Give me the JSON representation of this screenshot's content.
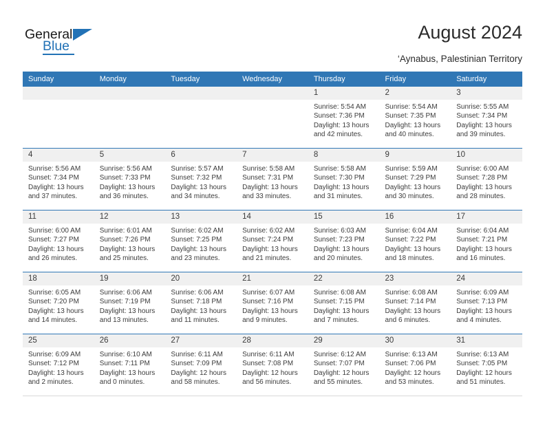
{
  "brand": {
    "name_top": "General",
    "name_bottom": "Blue",
    "accent_color": "#2272b6"
  },
  "header": {
    "title": "August 2024",
    "subtitle": "‘Aynabus, Palestinian Territory"
  },
  "theme": {
    "header_blue": "#3077b5",
    "daynum_band": "#f0f0f0",
    "text": "#3b3b3b"
  },
  "weekdays": [
    "Sunday",
    "Monday",
    "Tuesday",
    "Wednesday",
    "Thursday",
    "Friday",
    "Saturday"
  ],
  "labels": {
    "sunrise_prefix": "Sunrise:",
    "sunset_prefix": "Sunset:",
    "daylight_prefix": "Daylight:"
  },
  "weeks": [
    [
      {
        "day": "",
        "lines": []
      },
      {
        "day": "",
        "lines": []
      },
      {
        "day": "",
        "lines": []
      },
      {
        "day": "",
        "lines": []
      },
      {
        "day": "1",
        "lines": [
          "Sunrise: 5:54 AM",
          "Sunset: 7:36 PM",
          "Daylight: 13 hours",
          "and 42 minutes."
        ]
      },
      {
        "day": "2",
        "lines": [
          "Sunrise: 5:54 AM",
          "Sunset: 7:35 PM",
          "Daylight: 13 hours",
          "and 40 minutes."
        ]
      },
      {
        "day": "3",
        "lines": [
          "Sunrise: 5:55 AM",
          "Sunset: 7:34 PM",
          "Daylight: 13 hours",
          "and 39 minutes."
        ]
      }
    ],
    [
      {
        "day": "4",
        "lines": [
          "Sunrise: 5:56 AM",
          "Sunset: 7:34 PM",
          "Daylight: 13 hours",
          "and 37 minutes."
        ]
      },
      {
        "day": "5",
        "lines": [
          "Sunrise: 5:56 AM",
          "Sunset: 7:33 PM",
          "Daylight: 13 hours",
          "and 36 minutes."
        ]
      },
      {
        "day": "6",
        "lines": [
          "Sunrise: 5:57 AM",
          "Sunset: 7:32 PM",
          "Daylight: 13 hours",
          "and 34 minutes."
        ]
      },
      {
        "day": "7",
        "lines": [
          "Sunrise: 5:58 AM",
          "Sunset: 7:31 PM",
          "Daylight: 13 hours",
          "and 33 minutes."
        ]
      },
      {
        "day": "8",
        "lines": [
          "Sunrise: 5:58 AM",
          "Sunset: 7:30 PM",
          "Daylight: 13 hours",
          "and 31 minutes."
        ]
      },
      {
        "day": "9",
        "lines": [
          "Sunrise: 5:59 AM",
          "Sunset: 7:29 PM",
          "Daylight: 13 hours",
          "and 30 minutes."
        ]
      },
      {
        "day": "10",
        "lines": [
          "Sunrise: 6:00 AM",
          "Sunset: 7:28 PM",
          "Daylight: 13 hours",
          "and 28 minutes."
        ]
      }
    ],
    [
      {
        "day": "11",
        "lines": [
          "Sunrise: 6:00 AM",
          "Sunset: 7:27 PM",
          "Daylight: 13 hours",
          "and 26 minutes."
        ]
      },
      {
        "day": "12",
        "lines": [
          "Sunrise: 6:01 AM",
          "Sunset: 7:26 PM",
          "Daylight: 13 hours",
          "and 25 minutes."
        ]
      },
      {
        "day": "13",
        "lines": [
          "Sunrise: 6:02 AM",
          "Sunset: 7:25 PM",
          "Daylight: 13 hours",
          "and 23 minutes."
        ]
      },
      {
        "day": "14",
        "lines": [
          "Sunrise: 6:02 AM",
          "Sunset: 7:24 PM",
          "Daylight: 13 hours",
          "and 21 minutes."
        ]
      },
      {
        "day": "15",
        "lines": [
          "Sunrise: 6:03 AM",
          "Sunset: 7:23 PM",
          "Daylight: 13 hours",
          "and 20 minutes."
        ]
      },
      {
        "day": "16",
        "lines": [
          "Sunrise: 6:04 AM",
          "Sunset: 7:22 PM",
          "Daylight: 13 hours",
          "and 18 minutes."
        ]
      },
      {
        "day": "17",
        "lines": [
          "Sunrise: 6:04 AM",
          "Sunset: 7:21 PM",
          "Daylight: 13 hours",
          "and 16 minutes."
        ]
      }
    ],
    [
      {
        "day": "18",
        "lines": [
          "Sunrise: 6:05 AM",
          "Sunset: 7:20 PM",
          "Daylight: 13 hours",
          "and 14 minutes."
        ]
      },
      {
        "day": "19",
        "lines": [
          "Sunrise: 6:06 AM",
          "Sunset: 7:19 PM",
          "Daylight: 13 hours",
          "and 13 minutes."
        ]
      },
      {
        "day": "20",
        "lines": [
          "Sunrise: 6:06 AM",
          "Sunset: 7:18 PM",
          "Daylight: 13 hours",
          "and 11 minutes."
        ]
      },
      {
        "day": "21",
        "lines": [
          "Sunrise: 6:07 AM",
          "Sunset: 7:16 PM",
          "Daylight: 13 hours",
          "and 9 minutes."
        ]
      },
      {
        "day": "22",
        "lines": [
          "Sunrise: 6:08 AM",
          "Sunset: 7:15 PM",
          "Daylight: 13 hours",
          "and 7 minutes."
        ]
      },
      {
        "day": "23",
        "lines": [
          "Sunrise: 6:08 AM",
          "Sunset: 7:14 PM",
          "Daylight: 13 hours",
          "and 6 minutes."
        ]
      },
      {
        "day": "24",
        "lines": [
          "Sunrise: 6:09 AM",
          "Sunset: 7:13 PM",
          "Daylight: 13 hours",
          "and 4 minutes."
        ]
      }
    ],
    [
      {
        "day": "25",
        "lines": [
          "Sunrise: 6:09 AM",
          "Sunset: 7:12 PM",
          "Daylight: 13 hours",
          "and 2 minutes."
        ]
      },
      {
        "day": "26",
        "lines": [
          "Sunrise: 6:10 AM",
          "Sunset: 7:11 PM",
          "Daylight: 13 hours",
          "and 0 minutes."
        ]
      },
      {
        "day": "27",
        "lines": [
          "Sunrise: 6:11 AM",
          "Sunset: 7:09 PM",
          "Daylight: 12 hours",
          "and 58 minutes."
        ]
      },
      {
        "day": "28",
        "lines": [
          "Sunrise: 6:11 AM",
          "Sunset: 7:08 PM",
          "Daylight: 12 hours",
          "and 56 minutes."
        ]
      },
      {
        "day": "29",
        "lines": [
          "Sunrise: 6:12 AM",
          "Sunset: 7:07 PM",
          "Daylight: 12 hours",
          "and 55 minutes."
        ]
      },
      {
        "day": "30",
        "lines": [
          "Sunrise: 6:13 AM",
          "Sunset: 7:06 PM",
          "Daylight: 12 hours",
          "and 53 minutes."
        ]
      },
      {
        "day": "31",
        "lines": [
          "Sunrise: 6:13 AM",
          "Sunset: 7:05 PM",
          "Daylight: 12 hours",
          "and 51 minutes."
        ]
      }
    ]
  ]
}
